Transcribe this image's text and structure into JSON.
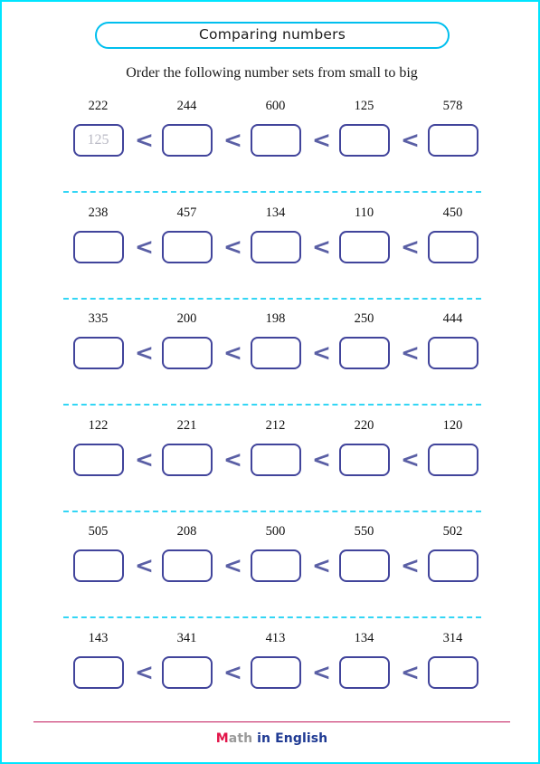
{
  "header": {
    "title": "Comparing numbers",
    "title_border_color": "#00bfee"
  },
  "instruction": "Order the following number sets from small to big",
  "page": {
    "border_color": "#00e5ff",
    "box_border_color": "#41449b",
    "divider_color": "#33d6f5",
    "comparator": "<",
    "comparator_color": "#5a5fa5",
    "prefilled_text_color": "#b9b9c4"
  },
  "exercises": [
    {
      "id": "row-1",
      "numbers": [
        "222",
        "244",
        "600",
        "125",
        "578"
      ],
      "answers": [
        "125",
        "",
        "",
        "",
        ""
      ]
    },
    {
      "id": "row-2",
      "numbers": [
        "238",
        "457",
        "134",
        "110",
        "450"
      ],
      "answers": [
        "",
        "",
        "",
        "",
        ""
      ]
    },
    {
      "id": "row-3",
      "numbers": [
        "335",
        "200",
        "198",
        "250",
        "444"
      ],
      "answers": [
        "",
        "",
        "",
        "",
        ""
      ]
    },
    {
      "id": "row-4",
      "numbers": [
        "122",
        "221",
        "212",
        "220",
        "120"
      ],
      "answers": [
        "",
        "",
        "",
        "",
        ""
      ]
    },
    {
      "id": "row-5",
      "numbers": [
        "505",
        "208",
        "500",
        "550",
        "502"
      ],
      "answers": [
        "",
        "",
        "",
        "",
        ""
      ]
    },
    {
      "id": "row-6",
      "numbers": [
        "143",
        "341",
        "413",
        "134",
        "314"
      ],
      "answers": [
        "",
        "",
        "",
        "",
        ""
      ]
    }
  ],
  "footer": {
    "logo_m": "M",
    "logo_ath": "ath",
    "logo_rest": " in English",
    "rule_color": "#c2185b"
  }
}
